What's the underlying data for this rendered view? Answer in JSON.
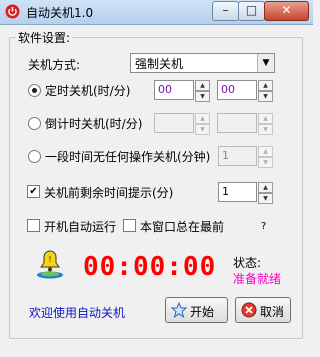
{
  "window": {
    "title": "自动关机1.0",
    "minimize_glyph": "–",
    "maximize_glyph": "□",
    "close_glyph": "✕",
    "app_icon": "red-power-icon"
  },
  "settings": {
    "group_label": "软件设置:",
    "shutdown_mode": {
      "label": "关机方式:",
      "value": "强制关机",
      "options_visible": [
        "强制关机"
      ]
    },
    "scheduled": {
      "label": "定时关机(时/分)",
      "hour": "00",
      "minute": "00",
      "selected": true
    },
    "countdown": {
      "label": "倒计时关机(时/分)",
      "hour": "",
      "minute": "",
      "selected": false
    },
    "idle": {
      "label": "一段时间无任何操作关机(分钟)",
      "value": "1",
      "selected": false
    },
    "remind": {
      "label": "关机前剩余时间提示(分)",
      "value": "1",
      "checked": true
    },
    "autorun": {
      "label": "开机自动运行",
      "checked": false
    },
    "topmost": {
      "label": "本窗口总在最前",
      "checked": false
    },
    "help": "?"
  },
  "clock": {
    "time": "00:00:00",
    "color": "#ff0000"
  },
  "status": {
    "label": "状态:",
    "value": "准备就绪",
    "value_color": "#ff00c8"
  },
  "footer": {
    "welcome": "欢迎使用自动关机",
    "welcome_color": "#0a18c0",
    "start_label": "开始",
    "cancel_label": "取消"
  }
}
